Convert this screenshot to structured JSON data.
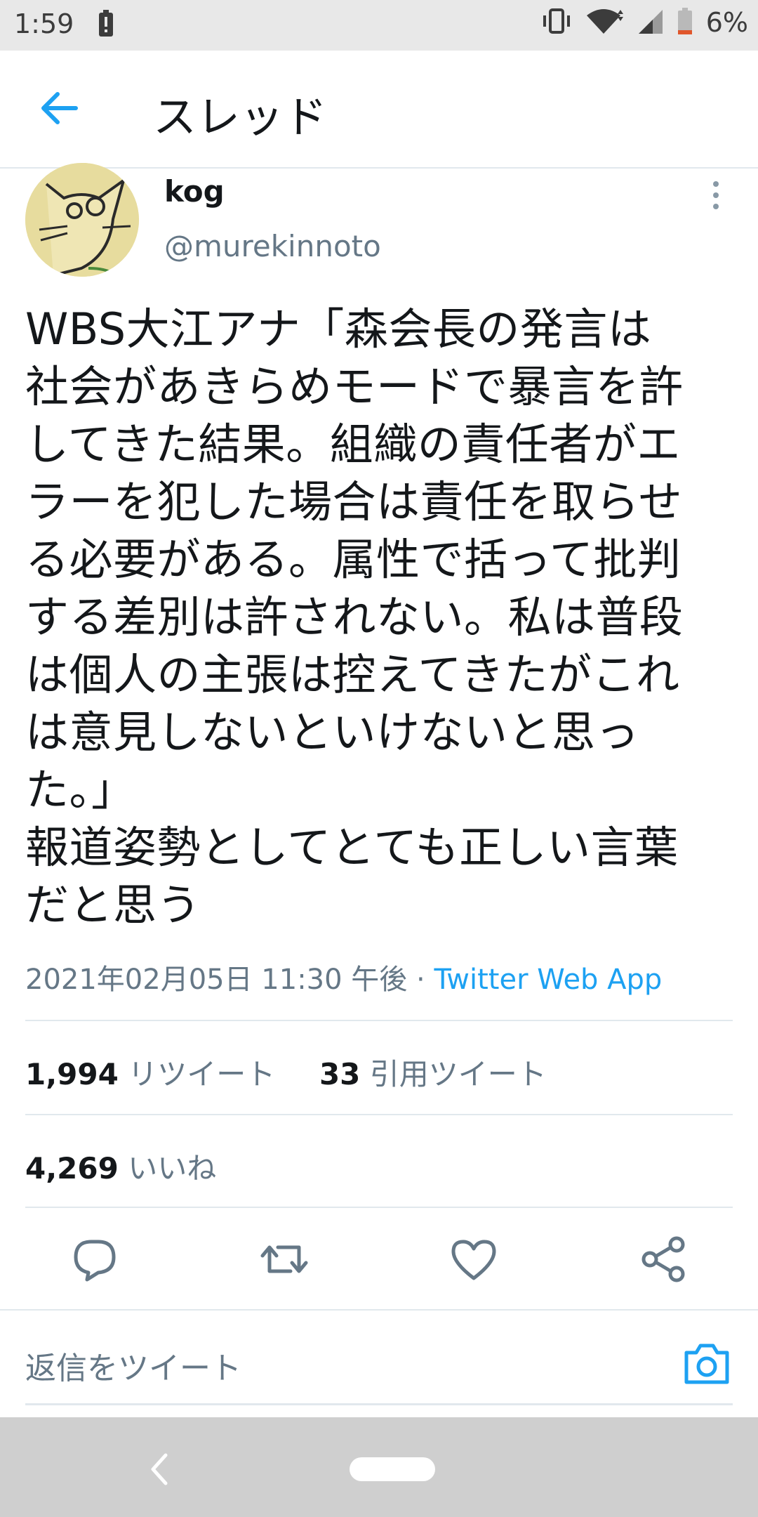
{
  "status_bar": {
    "time": "1:59",
    "battery": "6%"
  },
  "header": {
    "title": "スレッド"
  },
  "tweet": {
    "display_name": "kog",
    "handle": "@murekinnoto",
    "text": "WBS大江アナ「森会長の発言は\n社会があきらめモードで暴言を許\nしてきた結果。組織の責任者がエ\nラーを犯した場合は責任を取らせ\nる必要がある。属性で括って批判\nする差別は許されない。私は普段\nは個人の主張は控えてきたがこれ\nは意見しないといけないと思っ\nた。」\n報道姿勢としてとても正しい言葉\nだと思う",
    "timestamp": "2021年02月05日 11:30 午後",
    "separator": " · ",
    "source": "Twitter Web App"
  },
  "stats": {
    "retweets": "1,994",
    "retweets_label": "リツイート",
    "quotes": "33",
    "quotes_label": "引用ツイート",
    "likes": "4,269",
    "likes_label": "いいね"
  },
  "reply": {
    "placeholder": "返信をツイート"
  },
  "colors": {
    "accent": "#1da1f2",
    "muted": "#657786",
    "text": "#14171a",
    "divider": "#e1e8ed"
  },
  "icons": [
    "back-arrow-icon",
    "more-vertical-icon",
    "reply-icon",
    "retweet-icon",
    "like-icon",
    "share-icon",
    "camera-icon"
  ]
}
